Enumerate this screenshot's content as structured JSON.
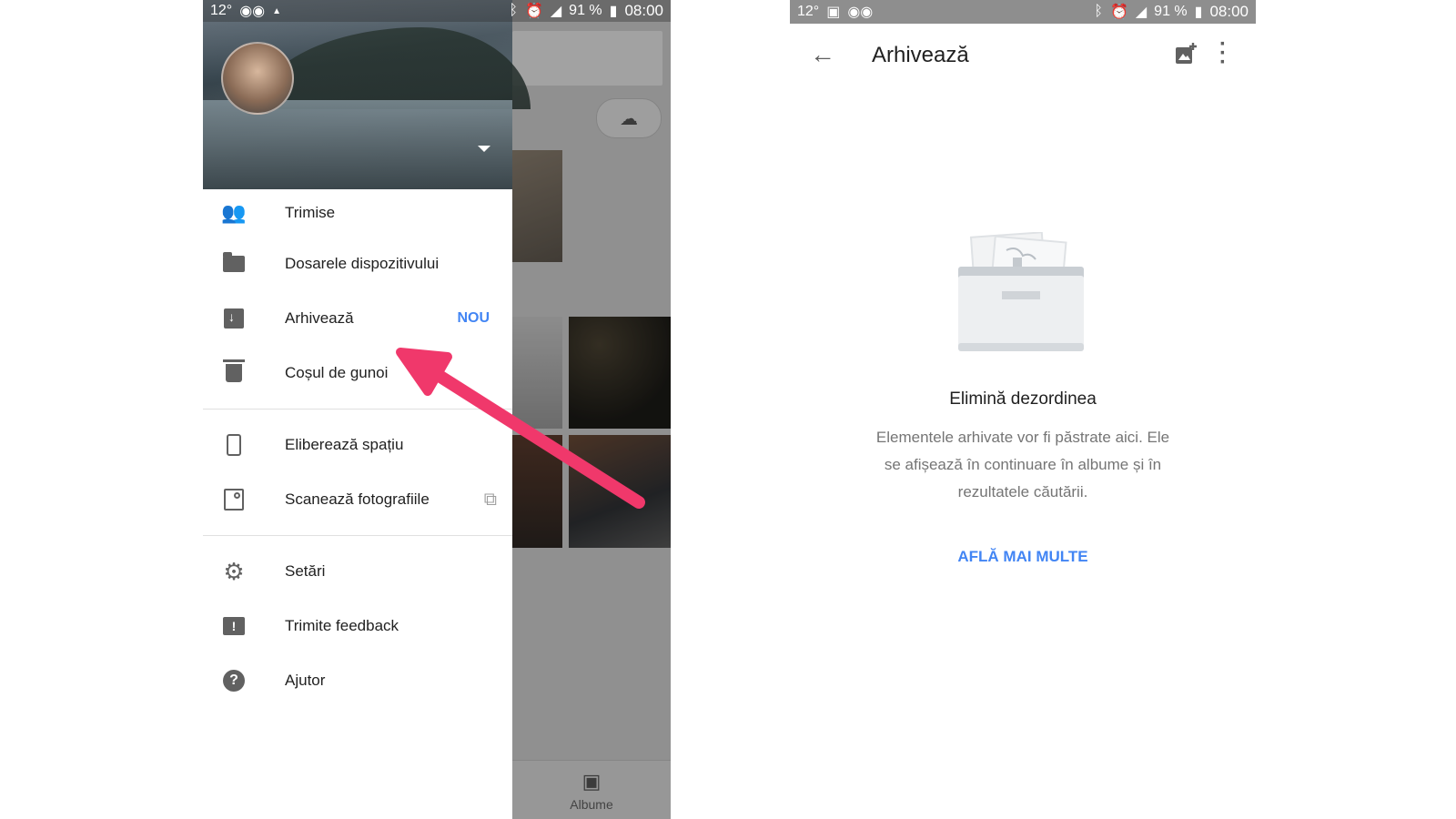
{
  "left_phone": {
    "status": {
      "temp": "12°",
      "battery": "91 %",
      "time": "08:00",
      "network": "4G"
    },
    "drawer": {
      "items": [
        {
          "label": "Trimise"
        },
        {
          "label": "Dosarele dispozitivului"
        },
        {
          "label": "Arhivează",
          "badge": "NOU"
        },
        {
          "label": "Coșul de gunoi"
        },
        {
          "label": "Eliberează spațiu"
        },
        {
          "label": "Scanează fotografiile"
        },
        {
          "label": "Setări"
        },
        {
          "label": "Trimite feedback"
        },
        {
          "label": "Ajutor"
        }
      ]
    },
    "background_app": {
      "bottom_tab": "Albume"
    },
    "annotation": {
      "arrow_color": "#f0386b"
    }
  },
  "right_phone": {
    "status": {
      "temp": "12°",
      "battery": "91 %",
      "time": "08:00",
      "network": "4G"
    },
    "appbar": {
      "title": "Arhivează"
    },
    "empty_state": {
      "title": "Elimină dezordinea",
      "description": "Elementele arhivate vor fi păstrate aici. Ele se afișează în continuare în albume și în rezultatele căutării.",
      "action": "AFLĂ MAI MULTE"
    }
  },
  "colors": {
    "accent": "#4285f4",
    "arrow": "#f0386b",
    "text": "#212121",
    "secondary_text": "#757575"
  }
}
